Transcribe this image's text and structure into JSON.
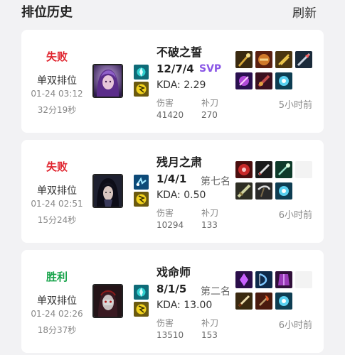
{
  "header": {
    "title": "排位历史",
    "refresh_label": "刷新"
  },
  "colors": {
    "loss": "#e0242e",
    "win": "#17a34a",
    "svp": "#8a57e6",
    "background": "#f2f2f4",
    "card": "#ffffff"
  },
  "labels": {
    "damage": "伤害",
    "cs": "补刀"
  },
  "matches": [
    {
      "result": "失败",
      "result_type": "loss",
      "mode": "单双排位",
      "datetime": "01-24 03:12",
      "duration": "32分19秒",
      "champion": "不破之誓",
      "champion_icon": "champion-portrait-purple-hair",
      "kda": "12/7/4",
      "badge": "SVP",
      "kda_ratio": "KDA: 2.29",
      "damage": "41420",
      "cs": "270",
      "time_ago": "5小时前",
      "spells": [
        "spell-teleport-icon",
        "spell-flash-icon"
      ]
    },
    {
      "result": "失败",
      "result_type": "loss",
      "mode": "单双排位",
      "datetime": "01-24 02:51",
      "duration": "15分24秒",
      "champion": "残月之肃",
      "champion_icon": "champion-portrait-dark-hair",
      "kda": "1/4/1",
      "badge": "第七名",
      "kda_ratio": "KDA: 0.50",
      "damage": "10294",
      "cs": "133",
      "time_ago": "6小时前",
      "spells": [
        "spell-ghost-icon",
        "spell-flash-icon"
      ]
    },
    {
      "result": "胜利",
      "result_type": "win",
      "mode": "单双排位",
      "datetime": "01-24 02:26",
      "duration": "18分37秒",
      "champion": "戏命师",
      "champion_icon": "champion-portrait-masked",
      "kda": "8/1/5",
      "badge": "第二名",
      "kda_ratio": "KDA: 13.00",
      "damage": "13510",
      "cs": "153",
      "time_ago": "6小时前",
      "spells": [
        "spell-teleport-icon",
        "spell-flash-icon"
      ]
    }
  ]
}
